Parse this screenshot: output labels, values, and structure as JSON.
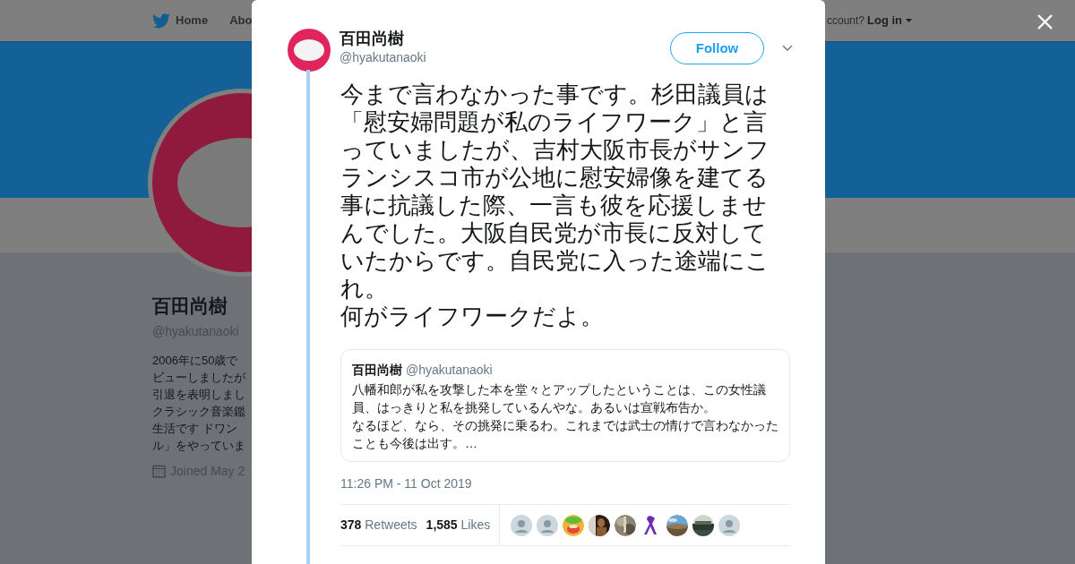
{
  "nav": {
    "items": [
      "Home",
      "Abo"
    ],
    "account_prompt": "ccount?",
    "login": "Log in"
  },
  "profile": {
    "name": "百田尚樹",
    "handle": "@hyakutanaoki",
    "bio_lines": [
      "2006年に50歳で",
      "ビューしましたが",
      "引退を表明しまし",
      "クラシック音楽鑑",
      "生活です ドワン",
      "ル」をやっていま"
    ],
    "joined": "Joined May 2"
  },
  "tweet": {
    "name": "百田尚樹",
    "handle": "@hyakutanaoki",
    "follow": "Follow",
    "paragraphs": [
      "今まで言わなかった事です。杉田議員は「慰安婦問題が私のライフワーク」と言っていましたが、吉村大阪市長がサンフランシスコ市が公地に慰安婦像を建てる事に抗議した際、一言も彼を応援しませんでした。大阪自民党が市長に反対していたからです。自民党に入った途端にこれ。",
      "何がライフワークだよ。"
    ],
    "quote": {
      "name": "百田尚樹",
      "handle": "@hyakutanaoki",
      "paragraphs": [
        "八幡和郎が私を攻撃した本を堂々とアップしたということは、この女性議員、はっきりと私を挑発しているんやな。あるいは宣戦布告か。",
        "なるほど、なら、その挑発に乗るわ。これまでは武士の情けで言わなかったことも今後は出す。…"
      ]
    },
    "time": "11:26 PM - 11 Oct 2019",
    "stats": [
      {
        "count": "378",
        "label": "Retweets"
      },
      {
        "count": "1,585",
        "label": "Likes"
      }
    ],
    "likers": [
      {
        "kind": "default"
      },
      {
        "kind": "default"
      },
      {
        "kind": "picture"
      },
      {
        "kind": "picture"
      },
      {
        "kind": "picture"
      },
      {
        "kind": "ribbon"
      },
      {
        "kind": "picture"
      },
      {
        "kind": "picture"
      },
      {
        "kind": "default"
      }
    ]
  }
}
